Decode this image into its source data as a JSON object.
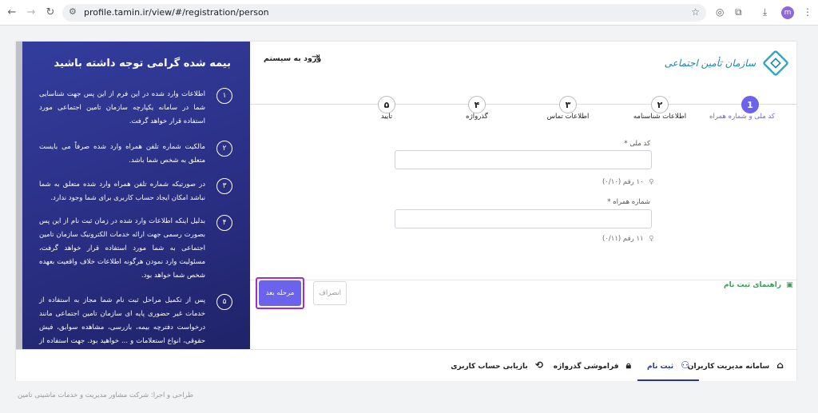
{
  "browser": {
    "url": "profile.tamin.ir/view/#/registration/person",
    "profile_initial": "m"
  },
  "header": {
    "logo_text": "سازمان تأمین اجتماعی",
    "login_label": "ورود به سیستم"
  },
  "info_panel": {
    "title": "بیمه شده گرامی توجه داشته باشید",
    "items": [
      {
        "num": "۱",
        "text": "اطلاعات وارد شده در این فرم از این پس جهت شناسایی شما در سامانه یکپارچه سازمان تامین اجتماعی مورد استفاده قرار خواهد گرفت."
      },
      {
        "num": "۲",
        "text": "مالکیت شماره تلفن همراه وارد شده صرفاً می بایست متعلق به شخص شما باشد."
      },
      {
        "num": "۳",
        "text": "در صورتیکه شماره تلفن همراه وارد شده متعلق به شما نباشد امکان ایجاد حساب کاربری برای شما وجود ندارد."
      },
      {
        "num": "۴",
        "text": "بدلیل اینکه اطلاعات وارد شده در زمان ثبت نام از این پس بصورت رسمی جهت ارائه خدمات الکترونیک سازمان تامین اجتماعی به شما مورد استفاده قرار خواهد گرفت، مسئولیت وارد نمودن هرگونه اطلاعات خلاف واقعیت بعهده شخص شما خواهد بود."
      },
      {
        "num": "۵",
        "text": "پس از تکمیل مراحل ثبت نام شما مجاز به استفاده از خدمات غیر حضوری پایه ای سازمان تامین اجتماعی مانند درخواست دفترچه بیمه، بازرسی، مشاهده سوابق، فیش حقوقی، انواع استعلامات و ... خواهید بود. جهت استفاده از خدمات"
      }
    ]
  },
  "stepper": {
    "steps": [
      {
        "num": "1",
        "label": "کد ملی و شماره همراه",
        "active": true
      },
      {
        "num": "۲",
        "label": "اطلاعات شناسنامه",
        "active": false
      },
      {
        "num": "۳",
        "label": "اطلاعات تماس",
        "active": false
      },
      {
        "num": "۴",
        "label": "گذرواژه",
        "active": false
      },
      {
        "num": "۵",
        "label": "تایید",
        "active": false
      }
    ]
  },
  "form": {
    "national_code": {
      "label": "کد ملی",
      "required": "*",
      "value": "",
      "hint": "۱۰ رقم (۰/۱۰)"
    },
    "mobile": {
      "label": "شماره همراه",
      "required": "*",
      "value": "",
      "hint": "۱۱ رقم (۰/۱۱)"
    }
  },
  "actions": {
    "guide_label": "راهنمای ثبت نام",
    "next_label": "مرحله بعد",
    "cancel_label": "انصراف"
  },
  "bottom_nav": {
    "items": [
      {
        "label": "سامانه مدیریت کاربران",
        "icon": "home-icon",
        "active": false
      },
      {
        "label": "ثبت نام",
        "icon": "add-user-icon",
        "active": true
      },
      {
        "label": "فراموشی گذرواژه",
        "icon": "lock-icon",
        "active": false
      },
      {
        "label": "بازیابی حساب کاربری",
        "icon": "recover-icon",
        "active": false
      }
    ]
  },
  "footer": {
    "text": "طراحی و اجرا: شرکت مشاور مدیریت و خدمات ماشینی تامین"
  },
  "colors": {
    "accent": "#6b63ec",
    "panel": "#2a2f84",
    "highlight": "#a32bd0",
    "guide": "#3c9f59"
  }
}
